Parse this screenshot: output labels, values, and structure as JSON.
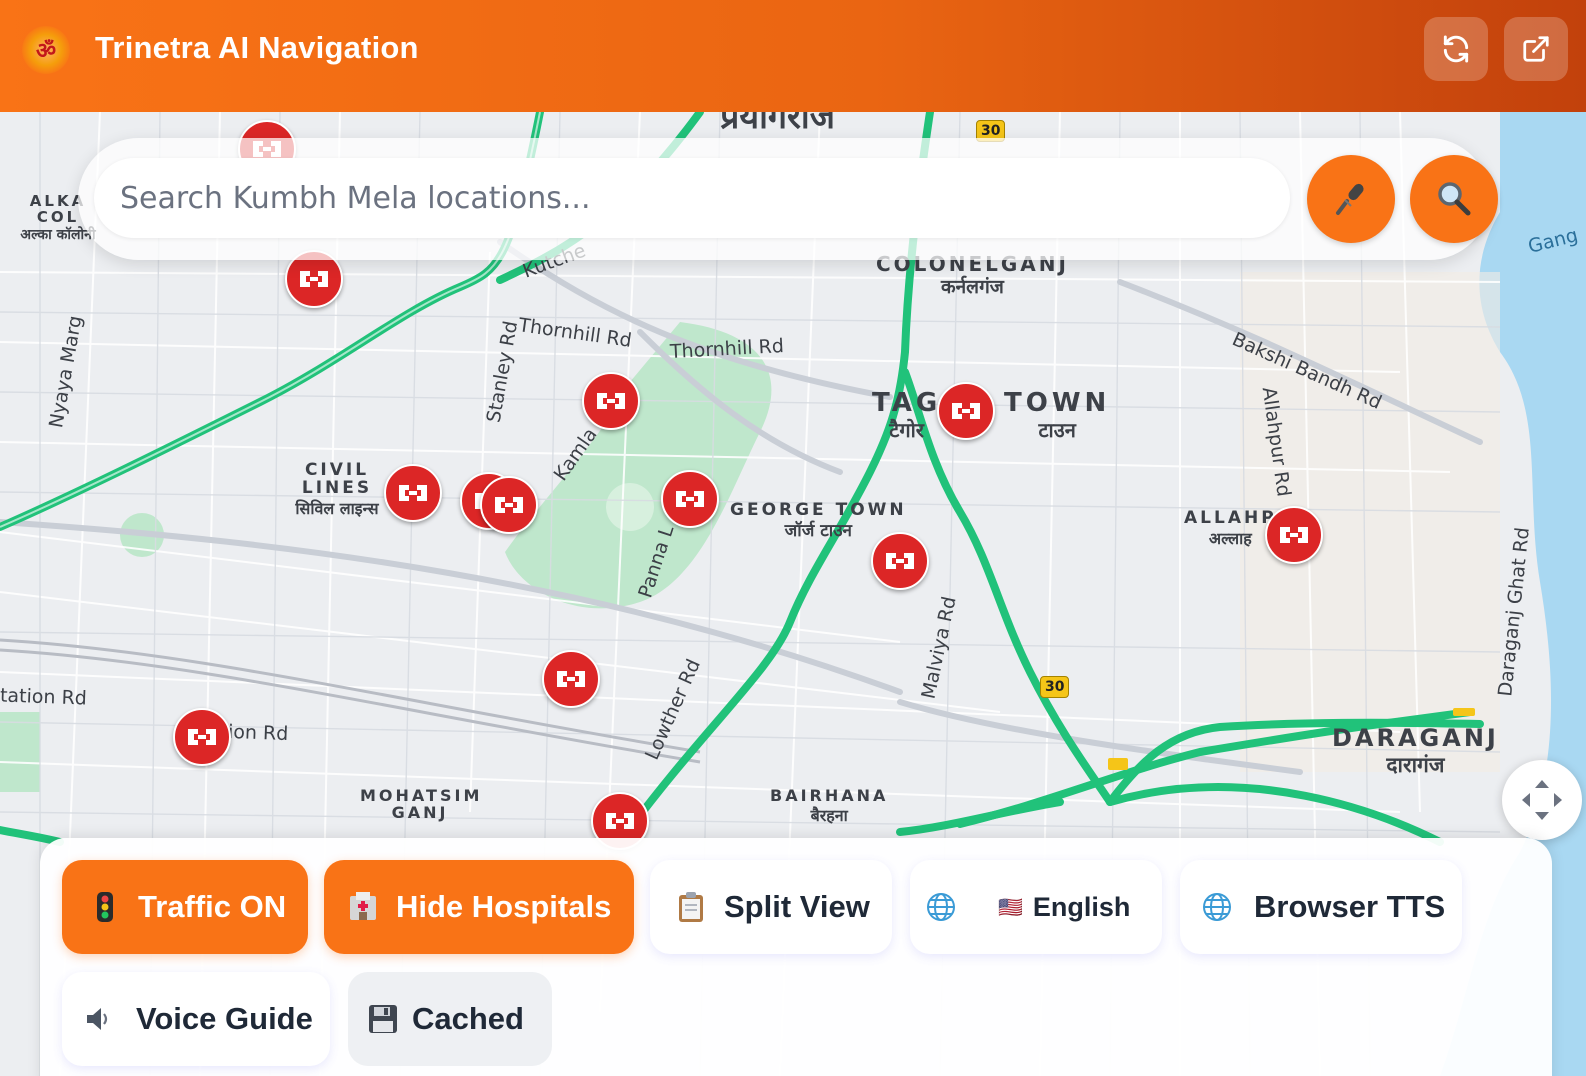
{
  "header": {
    "title": "Trinetra AI Navigation",
    "logo_icon": "om-symbol-icon",
    "actions": [
      {
        "name": "refresh-button",
        "icon": "refresh-icon"
      },
      {
        "name": "open-external-button",
        "icon": "external-link-icon"
      }
    ]
  },
  "search": {
    "placeholder": "Search Kumbh Mela locations...",
    "mic_icon": "microphone-icon",
    "search_icon": "magnifier-icon"
  },
  "map": {
    "area_labels": [
      {
        "en": "प्रयागराज",
        "hi": ""
      },
      {
        "en": "COLONELGANJ",
        "hi": "कर्नलगंज"
      },
      {
        "en": "TAG",
        "hi": "टैगोर"
      },
      {
        "en": "TOWN",
        "hi": "टाउन"
      },
      {
        "en": "CIVIL LINES",
        "hi": "सिविल लाइन्स"
      },
      {
        "en": "GEORGE TOWN",
        "hi": "जॉर्ज टाउन"
      },
      {
        "en": "ALLAHP",
        "hi": "अल्लाह"
      },
      {
        "en": "DARAGANJ",
        "hi": "दारागंज"
      },
      {
        "en": "MOHATSIM GANJ",
        "hi": ""
      },
      {
        "en": "BAIRHANA",
        "hi": "बैरहना"
      },
      {
        "en": "ALKA COL",
        "hi": "अल्का कॉलोनी"
      }
    ],
    "road_labels": [
      "Thornhill Rd",
      "Thornhill Rd",
      "Stanley Rd",
      "Kamla Ne",
      "Panna L",
      "Lowther Rd",
      "Malviya Rd",
      "Allahpur Rd",
      "Bakshi Bandh Rd",
      "Daraganj Ghat Rd",
      "Nyaya Marg",
      "tation Rd",
      "ion Rd",
      "Kutche",
      "Gang"
    ],
    "highway_shields": [
      "30",
      "30"
    ],
    "marker_icon": "hospital-marker-icon",
    "hospital_marker_count": 13,
    "colors": {
      "traffic_road": "#21c27a",
      "marker": "#dc2626",
      "accent": "#f97316",
      "water": "#a9d8f2",
      "park": "#bfe7cc"
    }
  },
  "controls": {
    "traffic": {
      "label": "Traffic ON",
      "icon": "traffic-light-icon"
    },
    "hospitals": {
      "label": "Hide Hospitals",
      "icon": "hospital-icon"
    },
    "split": {
      "label": "Split View",
      "icon": "clipboard-icon"
    },
    "language": {
      "label": "English",
      "icon": "globe-icon",
      "flag": "🇺🇸"
    },
    "tts": {
      "label": "Browser TTS",
      "icon": "globe-icon"
    },
    "voice": {
      "label": "Voice Guide",
      "icon": "speaker-icon"
    },
    "cached": {
      "label": "Cached",
      "icon": "floppy-disk-icon"
    }
  }
}
